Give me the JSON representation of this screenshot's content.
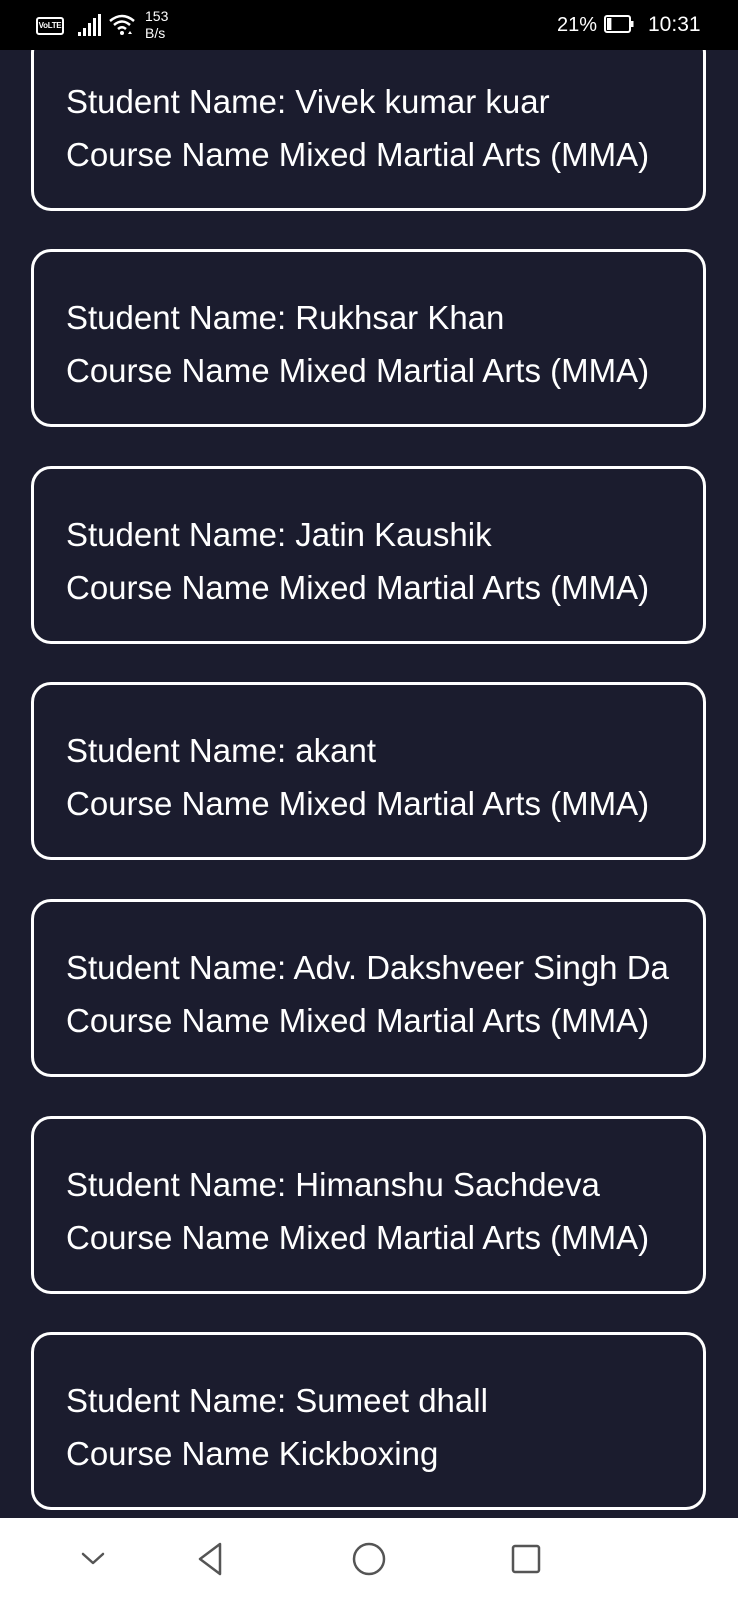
{
  "status_bar": {
    "volte": "VoLTE",
    "net_speed_value": "153",
    "net_speed_unit": "B/s",
    "battery_percent": "21%",
    "battery_level": 0.21,
    "time": "10:31"
  },
  "students": [
    {
      "name_line": "Student Name: Vivek kumar kuar",
      "course_line": "Course Name Mixed Martial Arts (MMA)"
    },
    {
      "name_line": "Student Name: Rukhsar Khan",
      "course_line": "Course Name Mixed Martial Arts (MMA)"
    },
    {
      "name_line": "Student Name: Jatin Kaushik",
      "course_line": "Course Name Mixed Martial Arts (MMA)"
    },
    {
      "name_line": "Student Name: akant",
      "course_line": "Course Name Mixed Martial Arts (MMA)"
    },
    {
      "name_line": "Student Name: Adv. Dakshveer Singh Da",
      "course_line": "Course Name Mixed Martial Arts (MMA)"
    },
    {
      "name_line": "Student Name: Himanshu Sachdeva",
      "course_line": "Course Name Mixed Martial Arts (MMA)"
    },
    {
      "name_line": "Student Name: Sumeet dhall",
      "course_line": "Course Name Kickboxing"
    }
  ],
  "nav_bar": {
    "icons": [
      "chevron-down-icon",
      "back-triangle-icon",
      "home-circle-icon",
      "recents-square-icon"
    ]
  },
  "colors": {
    "background": "#1b1c2e",
    "card_border": "#ffffff",
    "text": "#ffffff",
    "status_bar": "#000000",
    "nav_bar": "#ffffff",
    "nav_icon": "#555555"
  }
}
